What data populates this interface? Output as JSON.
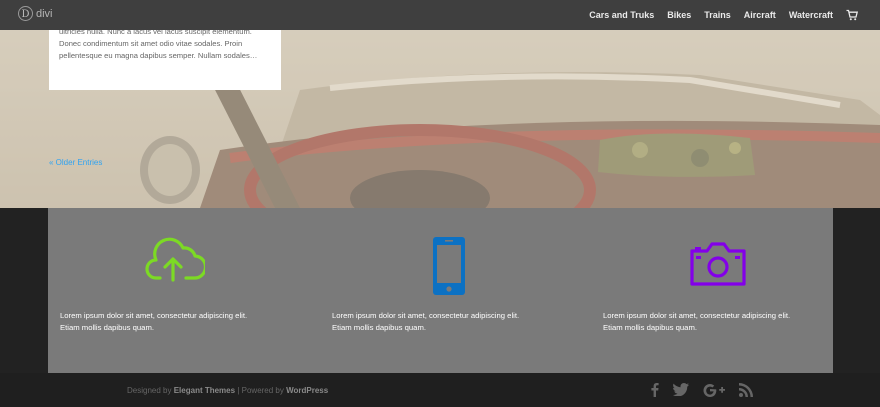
{
  "header": {
    "logo_text": "divi",
    "nav": [
      "Cars and Truks",
      "Bikes",
      "Trains",
      "Aircraft",
      "Watercraft"
    ]
  },
  "post": {
    "excerpt": "ultricies nulla. Nunc a lacus vel lacus suscipit elementum. Donec condimentum sit amet odio vitae sodales. Proin pellentesque eu magna dapibus semper. Nullam sodales…"
  },
  "pagination": {
    "older_label": "« Older Entries"
  },
  "blurbs": [
    {
      "icon": "cloud-upload-icon",
      "color": "#7cda24",
      "line1": "Lorem ipsum dolor sit amet, consectetur adipiscing elit.",
      "line2": "Etiam mollis dapibus quam."
    },
    {
      "icon": "smartphone-icon",
      "color": "#0c71c3",
      "line1": "Lorem ipsum dolor sit amet, consectetur adipiscing elit.",
      "line2": "Etiam mollis dapibus quam."
    },
    {
      "icon": "camera-icon",
      "color": "#8300e9",
      "line1": "Lorem ipsum dolor sit amet, consectetur adipiscing elit.",
      "line2": "Etiam mollis dapibus quam."
    }
  ],
  "footer": {
    "designed_by": "Designed by",
    "theme_author": "Elegant Themes",
    "separator": "|",
    "powered_by": "Powered by",
    "platform": "WordPress"
  },
  "social_icons": [
    "facebook-icon",
    "twitter-icon",
    "google-plus-icon",
    "rss-icon"
  ]
}
